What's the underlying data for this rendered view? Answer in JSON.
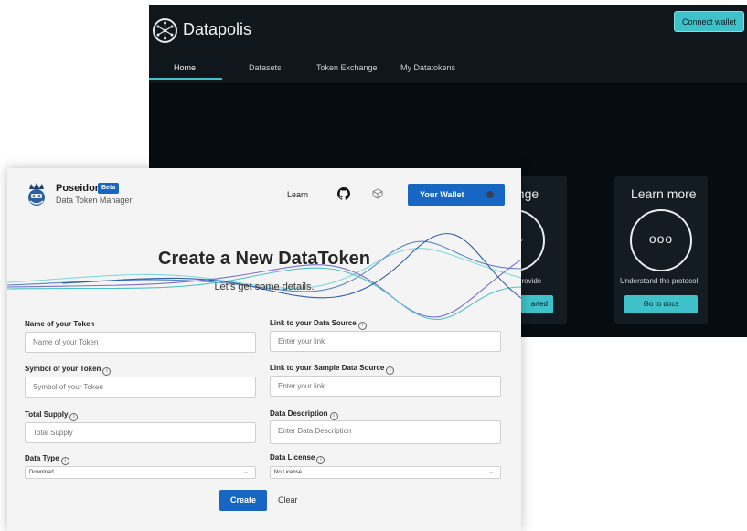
{
  "datapolis": {
    "title": "Datapolis",
    "connect_wallet": "Connect wallet",
    "tabs": [
      {
        "label": "Home",
        "active": true
      },
      {
        "label": "Datasets"
      },
      {
        "label": "Token Exchange"
      },
      {
        "label": "My Datatokens"
      }
    ],
    "cards": {
      "exchange": {
        "title": "ange",
        "text": "provide",
        "button": "arted",
        "icon": "down-arrow-icon"
      },
      "learn": {
        "title": "Learn more",
        "icon_text": "ooo",
        "text": "Understand the protocol",
        "button": "Go to docs"
      }
    },
    "accent": "#3fc1c9"
  },
  "poseidon": {
    "brand": "Poseidon",
    "badge": "Beta",
    "subtitle": "Data Token Manager",
    "nav": {
      "learn": "Learn",
      "github_icon": "github-icon",
      "box_icon": "box-icon"
    },
    "wallet": {
      "label": "Your Wallet"
    },
    "heading": "Create a New DataToken",
    "lead": "Let's get some details.",
    "form": {
      "token_name": {
        "label": "Name of your Token",
        "placeholder": "Name of your Token"
      },
      "data_source": {
        "label": "Link to your Data Source",
        "placeholder": "Enter your link"
      },
      "token_symbol": {
        "label": "Symbol of your Token",
        "placeholder": "Symbol of your Token"
      },
      "sample_source": {
        "label": "Link to your Sample Data Source",
        "placeholder": "Enter your link"
      },
      "total_supply": {
        "label": "Total Supply",
        "placeholder": "Total Supply"
      },
      "description": {
        "label": "Data Description",
        "placeholder": "Enter Data Description"
      },
      "data_type": {
        "label": "Data Type",
        "value": "Download"
      },
      "license": {
        "label": "Data License",
        "value": "No License"
      }
    },
    "create": "Create",
    "clear": "Clear",
    "accent": "#1766c3"
  }
}
